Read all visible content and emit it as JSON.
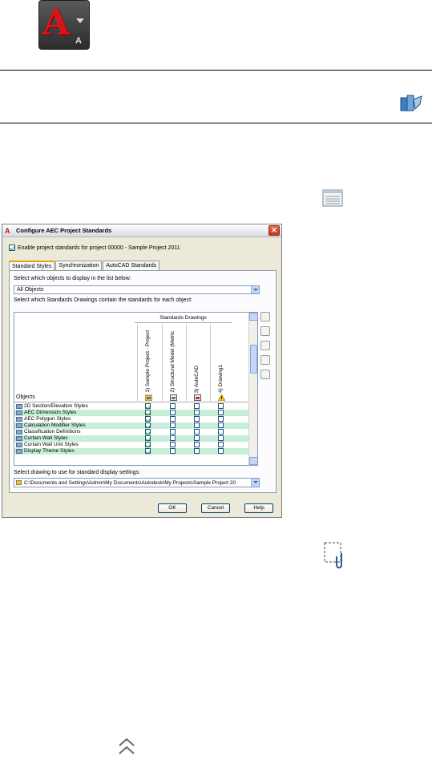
{
  "app_button": {
    "glyph": "A",
    "sub": "A"
  },
  "icons": {
    "toolbar_icon": "tool-palette-icon",
    "list_view_icon": "list-view-icon",
    "attachment_icon": "attachment-icon",
    "scroll_up_icon": "chevron-up-icon"
  },
  "dialog": {
    "title": "Configure AEC Project Standards",
    "enable_label": "Enable project standards for project 00000 - Sample Project 2011",
    "enable_checked": true,
    "tabs": [
      {
        "label": "Standard Styles",
        "active": true
      },
      {
        "label": "Synchronization",
        "active": false
      },
      {
        "label": "AutoCAD Standards",
        "active": false
      }
    ],
    "select_objects_label": "Select which objects to display in the list below:",
    "objects_filter_value": "All Objects",
    "standards_label": "Select which Standards Drawings contain the standards for each object:",
    "grid": {
      "objects_header": "Objects",
      "standards_header": "Standards Drawings",
      "columns": [
        "1) Sample Project - Project",
        "2) Structural Model (Metric",
        "3) AutoCAD",
        "4) Drawing1"
      ],
      "rows": [
        {
          "name": "2D Section/Elevation Styles",
          "checks": [
            true,
            false,
            false,
            false
          ]
        },
        {
          "name": "AEC Dimension Styles",
          "checks": [
            true,
            false,
            false,
            false
          ]
        },
        {
          "name": "AEC Polygon Styles",
          "checks": [
            true,
            false,
            false,
            false
          ]
        },
        {
          "name": "Calculation Modifier Styles",
          "checks": [
            true,
            false,
            false,
            false
          ]
        },
        {
          "name": "Classification Definitions",
          "checks": [
            true,
            false,
            false,
            false
          ]
        },
        {
          "name": "Curtain Wall Styles",
          "checks": [
            true,
            false,
            false,
            false
          ]
        },
        {
          "name": "Curtain Wall Unit Styles",
          "checks": [
            true,
            false,
            false,
            false
          ]
        },
        {
          "name": "Display Theme Styles",
          "checks": [
            true,
            false,
            false,
            false
          ]
        }
      ]
    },
    "display_settings_label": "Select drawing to use for standard display settings:",
    "display_settings_value": "C:\\Documents and Settings\\Admin\\My Documents\\Autodesk\\My Projects\\Sample Project 20",
    "buttons": {
      "ok": "OK",
      "cancel": "Cancel",
      "help": "Help"
    }
  }
}
